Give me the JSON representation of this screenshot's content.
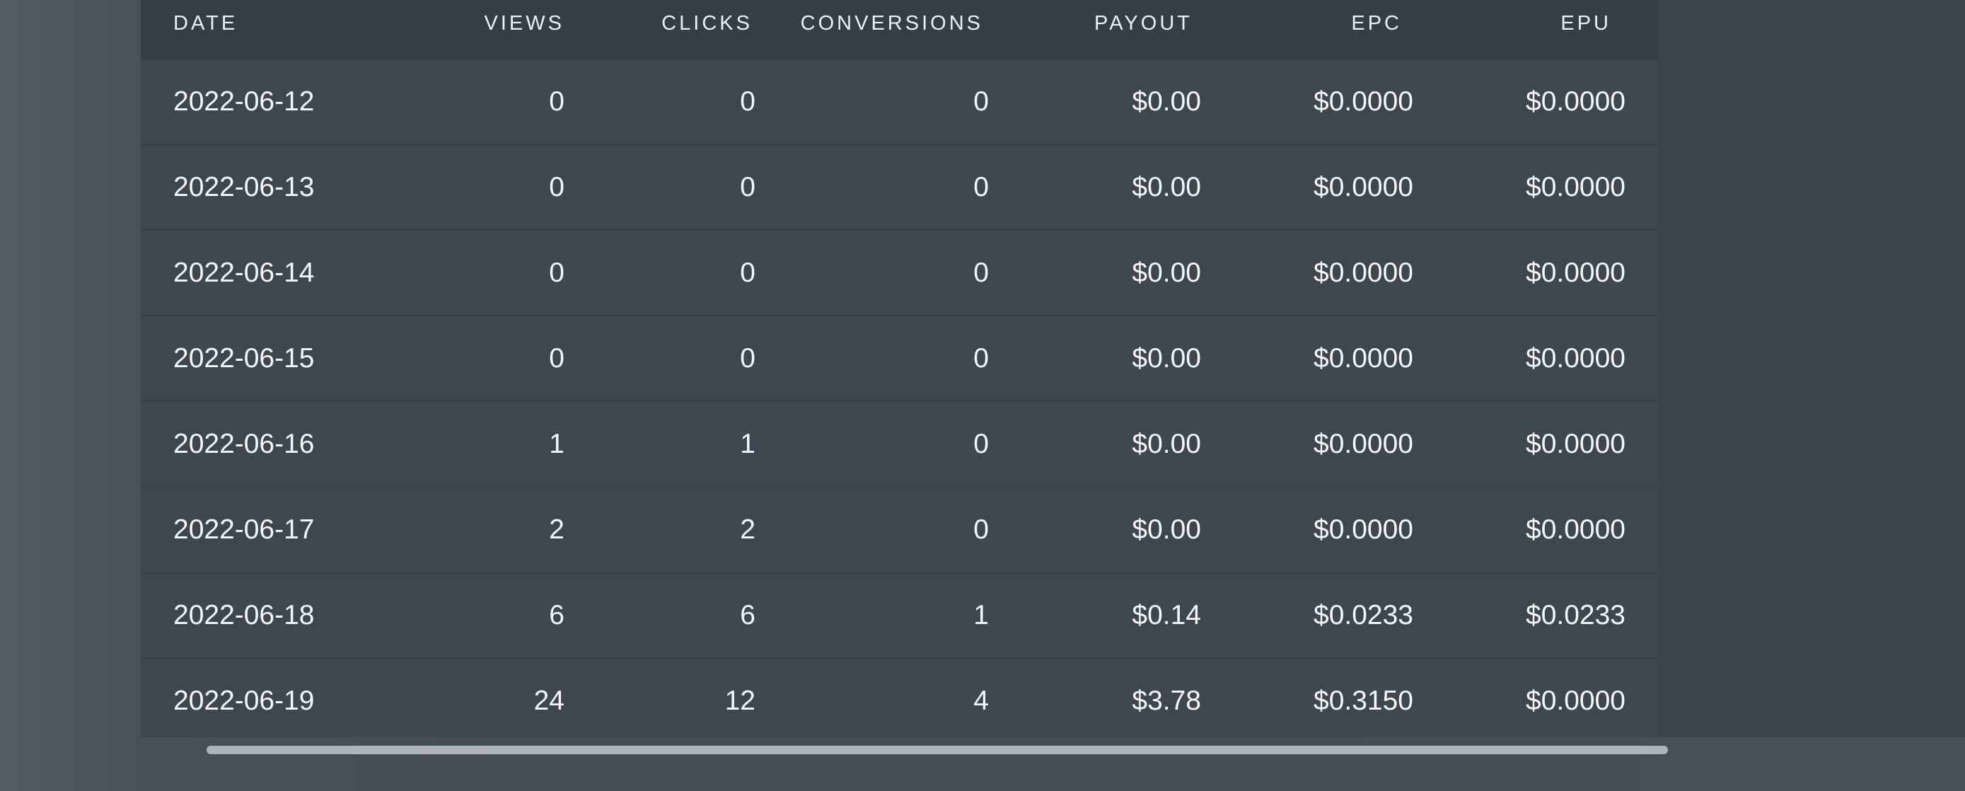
{
  "table": {
    "headers": {
      "date": "DATE",
      "views": "VIEWS",
      "clicks": "CLICKS",
      "conversions": "CONVERSIONS",
      "payout": "PAYOUT",
      "epc": "EPC",
      "epu": "EPU"
    },
    "rows": [
      {
        "date": "2022-06-12",
        "views": "0",
        "clicks": "0",
        "conversions": "0",
        "payout": "$0.00",
        "epc": "$0.0000",
        "epu": "$0.0000"
      },
      {
        "date": "2022-06-13",
        "views": "0",
        "clicks": "0",
        "conversions": "0",
        "payout": "$0.00",
        "epc": "$0.0000",
        "epu": "$0.0000"
      },
      {
        "date": "2022-06-14",
        "views": "0",
        "clicks": "0",
        "conversions": "0",
        "payout": "$0.00",
        "epc": "$0.0000",
        "epu": "$0.0000"
      },
      {
        "date": "2022-06-15",
        "views": "0",
        "clicks": "0",
        "conversions": "0",
        "payout": "$0.00",
        "epc": "$0.0000",
        "epu": "$0.0000"
      },
      {
        "date": "2022-06-16",
        "views": "1",
        "clicks": "1",
        "conversions": "0",
        "payout": "$0.00",
        "epc": "$0.0000",
        "epu": "$0.0000"
      },
      {
        "date": "2022-06-17",
        "views": "2",
        "clicks": "2",
        "conversions": "0",
        "payout": "$0.00",
        "epc": "$0.0000",
        "epu": "$0.0000"
      },
      {
        "date": "2022-06-18",
        "views": "6",
        "clicks": "6",
        "conversions": "1",
        "payout": "$0.14",
        "epc": "$0.0233",
        "epu": "$0.0233"
      },
      {
        "date": "2022-06-19",
        "views": "24",
        "clicks": "12",
        "conversions": "4",
        "payout": "$3.78",
        "epc": "$0.3150",
        "epu": "$0.0000"
      }
    ]
  },
  "colors": {
    "background": "#485156",
    "table_body": "#3d474d",
    "table_header": "#343e44",
    "row_divider": "#36414a",
    "text": "#f6f7f8",
    "scrollbar_thumb": "#aeb3b5"
  }
}
